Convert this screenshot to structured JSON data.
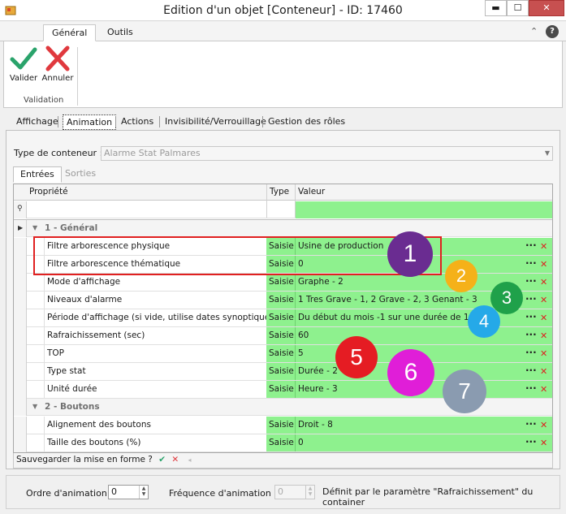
{
  "window": {
    "title": "Edition d'un objet [Conteneur] - ID: 17460",
    "min_glyph": "▬",
    "max_glyph": "☐",
    "close_glyph": "✕"
  },
  "ribbon": {
    "tabs": [
      "Général",
      "Outils"
    ],
    "collapse_glyph": "⌃",
    "help_glyph": "?",
    "buttons": {
      "validate": "Valider",
      "cancel": "Annuler"
    },
    "group_label": "Validation"
  },
  "main_tabs": [
    "Affichage",
    "Animation",
    "Actions",
    "Invisibilité/Verrouillage",
    "Gestion des rôles"
  ],
  "container_type": {
    "label": "Type de conteneur :",
    "value": "Alarme Stat Palmares"
  },
  "sub_tabs": [
    "Entrées",
    "Sorties"
  ],
  "grid": {
    "headers": {
      "property": "Propriété",
      "type": "Type",
      "value": "Valeur"
    },
    "categories": [
      "1 - Général",
      "2 - Boutons"
    ],
    "rows": [
      {
        "prop": "Filtre arborescence physique",
        "type": "Saisie",
        "value": "Usine de production"
      },
      {
        "prop": "Filtre arborescence thématique",
        "type": "Saisie",
        "value": "0"
      },
      {
        "prop": "Mode d'affichage",
        "type": "Saisie",
        "value": "Graphe - 2"
      },
      {
        "prop": "Niveaux d'alarme",
        "type": "Saisie",
        "value": "1 Tres Grave - 1,  2 Grave - 2,  3 Genant - 3"
      },
      {
        "prop": "Période d'affichage (si vide, utilise dates synoptique)",
        "type": "Saisie",
        "value": "Du début du mois -1 sur une durée de 1 mois"
      },
      {
        "prop": "Rafraichissement (sec)",
        "type": "Saisie",
        "value": "60"
      },
      {
        "prop": "TOP",
        "type": "Saisie",
        "value": "5"
      },
      {
        "prop": "Type stat",
        "type": "Saisie",
        "value": "Durée - 2"
      },
      {
        "prop": "Unité durée",
        "type": "Saisie",
        "value": "Heure - 3"
      },
      {
        "prop": "Alignement des boutons",
        "type": "Saisie",
        "value": "Droit - 8"
      },
      {
        "prop": "Taille des boutons (%)",
        "type": "Saisie",
        "value": "0"
      }
    ],
    "dots_glyph": "···",
    "delete_glyph": "✕"
  },
  "badges": [
    {
      "text": "1",
      "color": "#6a2c91"
    },
    {
      "text": "2",
      "color": "#f5b119"
    },
    {
      "text": "3",
      "color": "#1fa14a"
    },
    {
      "text": "4",
      "color": "#25a9e8"
    },
    {
      "text": "5",
      "color": "#e51c23"
    },
    {
      "text": "6",
      "color": "#e01ed8"
    },
    {
      "text": "7",
      "color": "#8a9bb0"
    }
  ],
  "status_bar": {
    "text": "Sauvegarder la mise en forme ?",
    "ok_glyph": "✔",
    "no_glyph": "✕",
    "arrow_glyph": "◂"
  },
  "bottom": {
    "order_label": "Ordre d'animation :",
    "order_value": "0",
    "freq_label": "Fréquence d'animation :",
    "freq_value": "0",
    "freq_note": "Définit par le paramètre \"Rafraichissement\" du container"
  },
  "colors": {
    "grid_value_bg": "#8ef18e",
    "accent_check": "#2aa36b",
    "accent_cross": "#e0393e"
  }
}
